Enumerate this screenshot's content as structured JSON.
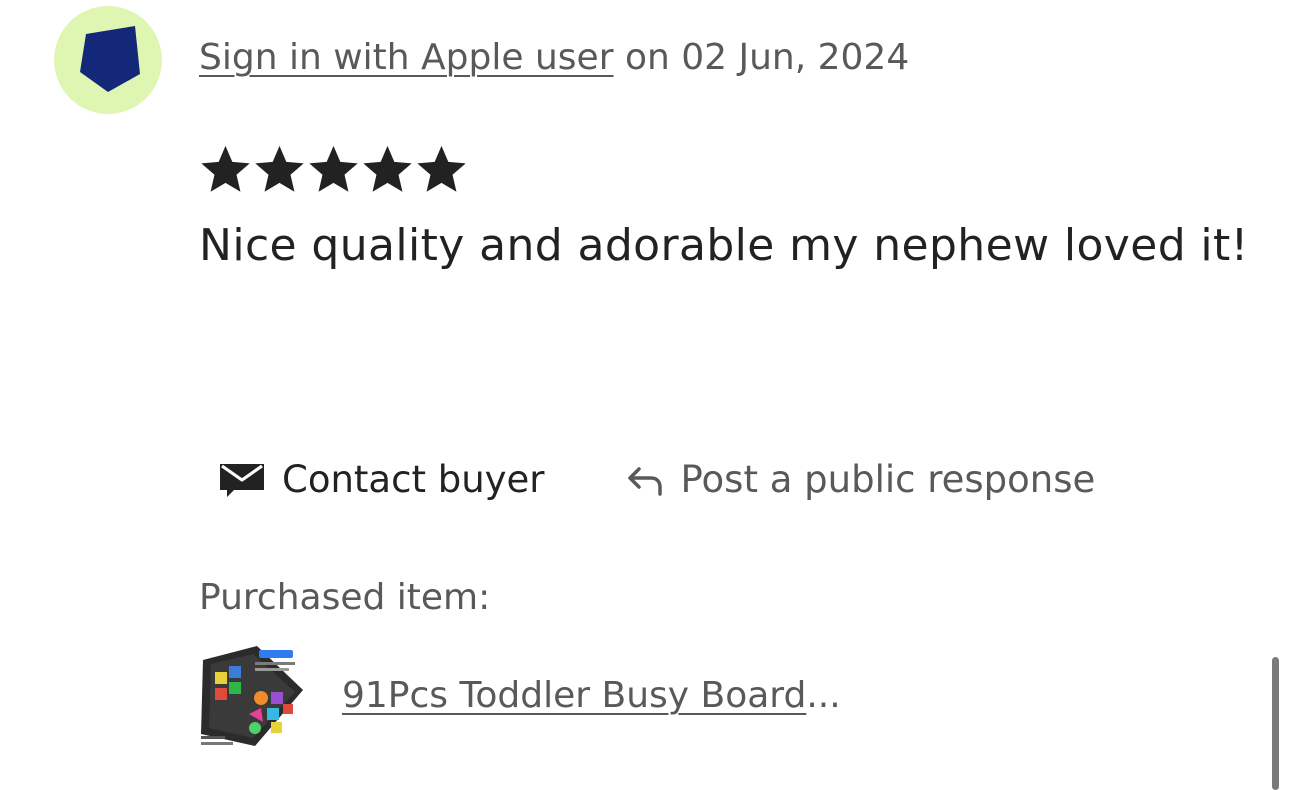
{
  "review": {
    "author_link": "Sign in with Apple user",
    "date_prefix": " on ",
    "date": "02 Jun, 2024",
    "rating": 5,
    "rating_max": 5,
    "text": "Nice quality and adorable my nephew loved it!"
  },
  "actions": {
    "contact_label": "Contact buyer",
    "contact_icon": "envelope-icon",
    "respond_label": "Post a public response",
    "respond_icon": "reply-arrow-icon"
  },
  "purchased": {
    "label": "Purchased item:",
    "item_title": "91Pcs Toddler Busy Board",
    "item_ellipsis": "..."
  },
  "colors": {
    "avatar_bg": "#dff6b2",
    "avatar_shape": "#14287a",
    "text_primary": "#222222",
    "text_secondary": "#595959"
  }
}
